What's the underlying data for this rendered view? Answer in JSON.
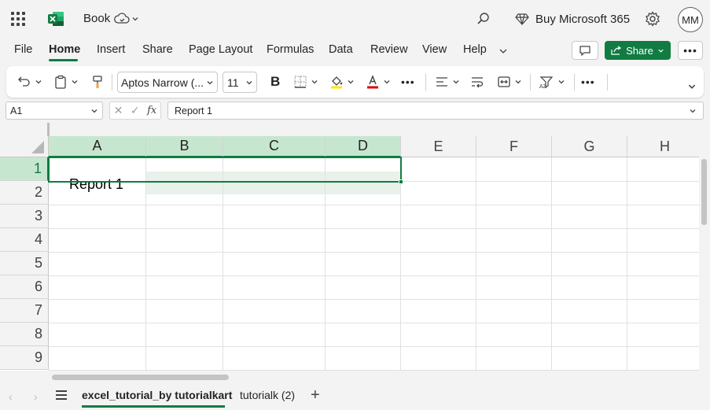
{
  "app": {
    "doc_title": "Book",
    "buy_label": "Buy Microsoft 365",
    "avatar_initials": "MM",
    "accent": "#107c41"
  },
  "menu": {
    "tabs": [
      {
        "label": "File"
      },
      {
        "label": "Home"
      },
      {
        "label": "Insert"
      },
      {
        "label": "Share"
      },
      {
        "label": "Page Layout"
      },
      {
        "label": "Formulas"
      },
      {
        "label": "Data"
      },
      {
        "label": "Review"
      },
      {
        "label": "View"
      },
      {
        "label": "Help"
      }
    ],
    "active_tab": "Home",
    "share_label": "Share"
  },
  "ribbon": {
    "font_name": "Aptos Narrow (...",
    "font_size": "11",
    "bold_label": "B",
    "fill_color": "#ffe600",
    "font_color": "#e00000"
  },
  "formula_bar": {
    "name_box": "A1",
    "fx_label": "fx",
    "formula": "Report 1"
  },
  "sheet": {
    "columns": [
      "A",
      "B",
      "C",
      "D",
      "E",
      "F",
      "G",
      "H"
    ],
    "rows": [
      "1",
      "2",
      "3",
      "4",
      "5",
      "6",
      "7",
      "8",
      "9"
    ],
    "cells": {
      "A1": "Report 1"
    },
    "selection": "A1:D1"
  },
  "sheet_tabs": {
    "tabs": [
      {
        "label": "excel_tutorial_by tutorialkart"
      },
      {
        "label": "tutorialk (2)"
      }
    ],
    "active": "excel_tutorial_by tutorialkart"
  }
}
